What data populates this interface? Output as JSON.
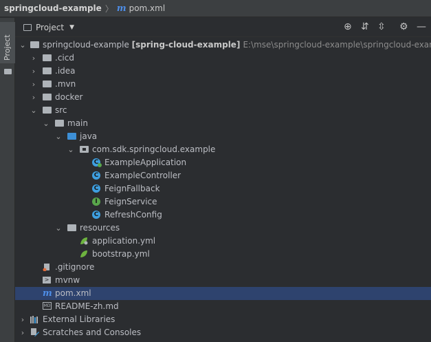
{
  "nav": {
    "project_name": "springcloud-example",
    "separator": "〉",
    "file_icon": "m",
    "file_name": "pom.xml"
  },
  "side_strip": {
    "tab_label": "Project"
  },
  "panel": {
    "title": "Project",
    "header_icons": [
      "locate-icon",
      "expand-all-icon",
      "collapse-all-icon",
      "gear-icon",
      "minimize-icon"
    ]
  },
  "tree": {
    "root_name": "springcloud-example",
    "root_module": "[spring-cloud-example]",
    "root_path": "E:\\mse\\springcloud-example\\springcloud-example",
    "cicd": ".cicd",
    "idea": ".idea",
    "mvn": ".mvn",
    "docker": "docker",
    "src": "src",
    "main": "main",
    "java": "java",
    "package": "com.sdk.springcloud.example",
    "classes": [
      "ExampleApplication",
      "ExampleController",
      "FeignFallback",
      "FeignService",
      "RefreshConfig"
    ],
    "resources": "resources",
    "app_yml": "application.yml",
    "bootstrap_yml": "bootstrap.yml",
    "gitignore": ".gitignore",
    "mvnw": "mvnw",
    "pom": "pom.xml",
    "readme": "README-zh.md",
    "ext_libs": "External Libraries",
    "scratches": "Scratches and Consoles"
  },
  "colors": {
    "accent": "#3e9fe0",
    "selection": "#2e436e",
    "folder_source": "#3d8fd6",
    "interface": "#59a64b",
    "maven": "#4e8ee8"
  }
}
